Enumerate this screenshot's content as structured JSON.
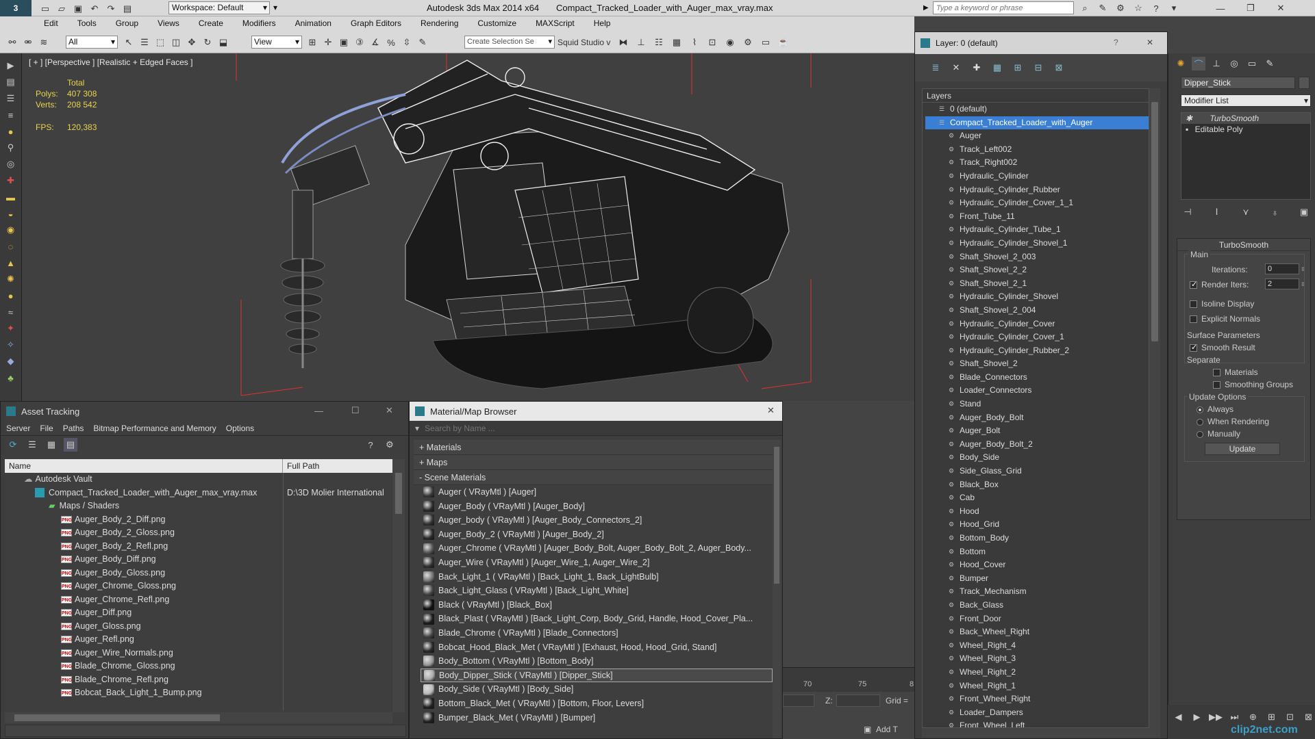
{
  "titlebar": {
    "app": "Autodesk 3ds Max  2014 x64",
    "file": "Compact_Tracked_Loader_with_Auger_max_vray.max",
    "workspace": "Workspace: Default",
    "search_placeholder": "Type a keyword or phrase"
  },
  "menu": [
    "Edit",
    "Tools",
    "Group",
    "Views",
    "Create",
    "Modifiers",
    "Animation",
    "Graph Editors",
    "Rendering",
    "Customize",
    "MAXScript",
    "Help"
  ],
  "toolbar": {
    "filter": "All",
    "ref_coord": "View",
    "selection_set": "Create Selection Se",
    "squid": "Squid Studio v"
  },
  "viewport": {
    "label": "[ + ] [Perspective ] [Realistic + Edged Faces ]",
    "stats_header": "Total",
    "polys_label": "Polys:",
    "polys": "407 308",
    "verts_label": "Verts:",
    "verts": "208 542",
    "fps_label": "FPS:",
    "fps": "120,383"
  },
  "layer_window": {
    "title": "Layer: 0 (default)",
    "list_header": "Layers",
    "layers": [
      {
        "name": "0 (default)",
        "level": 0,
        "selected": false
      },
      {
        "name": "Compact_Tracked_Loader_with_Auger",
        "level": 0,
        "selected": true
      }
    ],
    "objects": [
      "Auger",
      "Track_Left002",
      "Track_Right002",
      "Hydraulic_Cylinder",
      "Hydraulic_Cylinder_Rubber",
      "Hydraulic_Cylinder_Cover_1_1",
      "Front_Tube_11",
      "Hydraulic_Cylinder_Tube_1",
      "Hydraulic_Cylinder_Shovel_1",
      "Shaft_Shovel_2_003",
      "Shaft_Shovel_2_2",
      "Shaft_Shovel_2_1",
      "Hydraulic_Cylinder_Shovel",
      "Shaft_Shovel_2_004",
      "Hydraulic_Cylinder_Cover",
      "Hydraulic_Cylinder_Cover_1",
      "Hydraulic_Cylinder_Rubber_2",
      "Shaft_Shovel_2",
      "Blade_Connectors",
      "Loader_Connectors",
      "Stand",
      "Auger_Body_Bolt",
      "Auger_Bolt",
      "Auger_Body_Bolt_2",
      "Body_Side",
      "Side_Glass_Grid",
      "Black_Box",
      "Cab",
      "Hood",
      "Hood_Grid",
      "Bottom_Body",
      "Bottom",
      "Hood_Cover",
      "Bumper",
      "Track_Mechanism",
      "Back_Glass",
      "Front_Door",
      "Back_Wheel_Right",
      "Wheel_Right_4",
      "Wheel_Right_3",
      "Wheel_Right_2",
      "Wheel_Right_1",
      "Front_Wheel_Right",
      "Loader_Dampers",
      "Front_Wheel_Left"
    ]
  },
  "command_panel": {
    "object_name": "Dipper_Stick",
    "modifier_list": "Modifier List",
    "stack": [
      "TurboSmooth",
      "Editable Poly"
    ],
    "rollout_title": "TurboSmooth",
    "main_label": "Main",
    "iterations_label": "Iterations:",
    "iterations": "0",
    "render_iters_label": "Render Iters:",
    "render_iters": "2",
    "isoline": "Isoline Display",
    "explicit_normals": "Explicit Normals",
    "surface_params": "Surface Parameters",
    "smooth_result": "Smooth Result",
    "separate": "Separate",
    "materials": "Materials",
    "smoothing_groups": "Smoothing Groups",
    "update_options": "Update Options",
    "always": "Always",
    "when_rendering": "When Rendering",
    "manually": "Manually",
    "update_button": "Update"
  },
  "asset_tracking": {
    "title": "Asset Tracking",
    "menu": [
      "Server",
      "File",
      "Paths",
      "Bitmap Performance and Memory",
      "Options"
    ],
    "col_name": "Name",
    "col_path": "Full Path",
    "vault": "Autodesk Vault",
    "file": "Compact_Tracked_Loader_with_Auger_max_vray.max",
    "file_path": "D:\\3D Molier International",
    "folder": "Maps / Shaders",
    "files": [
      "Auger_Body_2_Diff.png",
      "Auger_Body_2_Gloss.png",
      "Auger_Body_2_Refl.png",
      "Auger_Body_Diff.png",
      "Auger_Body_Gloss.png",
      "Auger_Chrome_Gloss.png",
      "Auger_Chrome_Refl.png",
      "Auger_Diff.png",
      "Auger_Gloss.png",
      "Auger_Refl.png",
      "Auger_Wire_Normals.png",
      "Blade_Chrome_Gloss.png",
      "Blade_Chrome_Refl.png",
      "Bobcat_Back_Light_1_Bump.png"
    ]
  },
  "material_browser": {
    "title": "Material/Map Browser",
    "search_placeholder": "Search by Name ...",
    "sections": [
      "+ Materials",
      "+ Maps",
      "- Scene Materials"
    ],
    "items": [
      {
        "text": "Auger  ( VRayMtl )  [Auger]",
        "color": "#3a3a3a"
      },
      {
        "text": "Auger_Body  ( VRayMtl )  [Auger_Body]",
        "color": "#2c2c2c"
      },
      {
        "text": "Auger_body  ( VRayMtl )  [Auger_Body_Connectors_2]",
        "color": "#333"
      },
      {
        "text": "Auger_Body_2  ( VRayMtl )  [Auger_Body_2]",
        "color": "#2a2a2a"
      },
      {
        "text": "Auger_Chrome  ( VRayMtl )  [Auger_Body_Bolt, Auger_Body_Bolt_2, Auger_Body...",
        "color": "#555"
      },
      {
        "text": "Auger_Wire  ( VRayMtl )  [Auger_Wire_1, Auger_Wire_2]",
        "color": "#333"
      },
      {
        "text": "Back_Light_1  ( VRayMtl )  [Back_Light_1, Back_LightBulb]",
        "color": "#777"
      },
      {
        "text": "Back_Light_Glass  ( VRayMtl )  [Back_Light_White]",
        "color": "#444"
      },
      {
        "text": "Black  ( VRayMtl )  [Black_Box]",
        "color": "#111"
      },
      {
        "text": "Black_Plast  ( VRayMtl )  [Back_Light_Corp, Body_Grid, Handle, Hood_Cover_Pla...",
        "color": "#1c1c1c"
      },
      {
        "text": "Blade_Chrome  ( VRayMtl )  [Blade_Connectors]",
        "color": "#444"
      },
      {
        "text": "Bobcat_Hood_Black_Met  ( VRayMtl )  [Exhaust, Hood, Hood_Grid, Stand]",
        "color": "#2a2a2a"
      },
      {
        "text": "Body_Bottom  ( VRayMtl )  [Bottom_Body]",
        "color": "#999"
      },
      {
        "text": "Body_Dipper_Stick  ( VRayMtl )  [Dipper_Stick]",
        "color": "#aaa"
      },
      {
        "text": "Body_Side  ( VRayMtl )  [Body_Side]",
        "color": "#bbb"
      },
      {
        "text": "Bottom_Black_Met  ( VRayMtl )  [Bottom, Floor, Levers]",
        "color": "#222"
      },
      {
        "text": "Bumper_Black_Met  ( VRayMtl )  [Bumper]",
        "color": "#222"
      }
    ],
    "selected_index": 13
  },
  "timeline": {
    "ticks": [
      "70",
      "75",
      "8"
    ],
    "z_label": "Z:",
    "grid_label": "Grid =",
    "add_label": "Add T"
  },
  "watermark": "clip2net.com"
}
